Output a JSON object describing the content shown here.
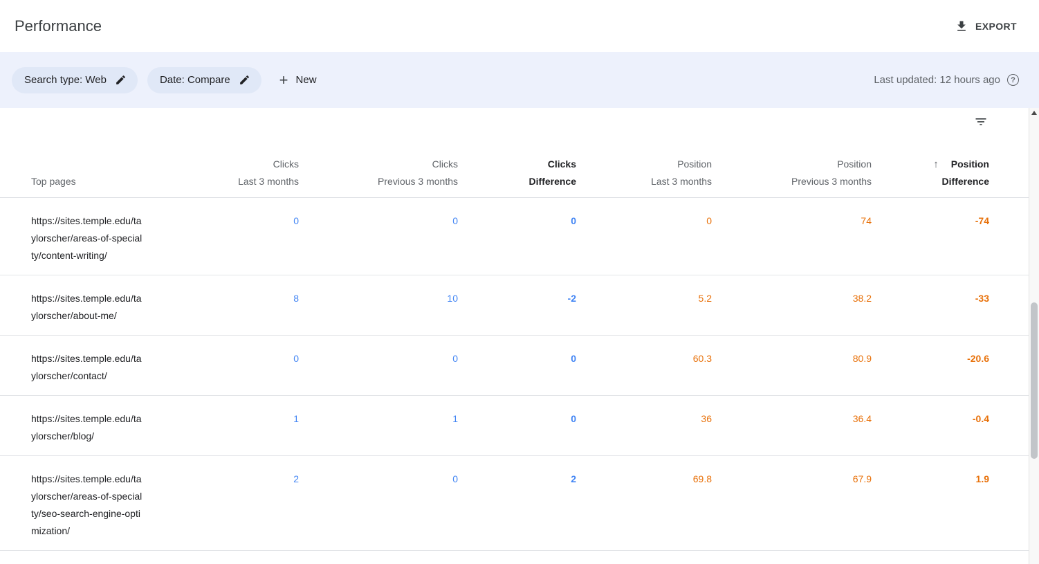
{
  "header": {
    "title": "Performance",
    "export_label": "EXPORT"
  },
  "filter_bar": {
    "chips": [
      {
        "label": "Search type: Web"
      },
      {
        "label": "Date: Compare"
      }
    ],
    "plus_symbol": "+",
    "new_label": "New",
    "last_updated": "Last updated: 12 hours ago",
    "help_symbol": "?"
  },
  "table": {
    "row_header": "Top pages",
    "sort_arrow": "↑",
    "columns": [
      {
        "line1": "Clicks",
        "line2": "Last 3 months"
      },
      {
        "line1": "Clicks",
        "line2": "Previous 3 months"
      },
      {
        "line1": "Clicks",
        "line2": "Difference"
      },
      {
        "line1": "Position",
        "line2": "Last 3 months"
      },
      {
        "line1": "Position",
        "line2": "Previous 3 months"
      },
      {
        "line1": "Position",
        "line2": "Difference"
      }
    ],
    "rows": [
      {
        "page": "https://sites.temple.edu/taylorscher/areas-of-specialty/content-writing/",
        "clicks_last": "0",
        "clicks_previous": "0",
        "clicks_difference": "0",
        "position_last": "0",
        "position_previous": "74",
        "position_difference": "-74"
      },
      {
        "page": "https://sites.temple.edu/taylorscher/about-me/",
        "clicks_last": "8",
        "clicks_previous": "10",
        "clicks_difference": "-2",
        "position_last": "5.2",
        "position_previous": "38.2",
        "position_difference": "-33"
      },
      {
        "page": "https://sites.temple.edu/taylorscher/contact/",
        "clicks_last": "0",
        "clicks_previous": "0",
        "clicks_difference": "0",
        "position_last": "60.3",
        "position_previous": "80.9",
        "position_difference": "-20.6"
      },
      {
        "page": "https://sites.temple.edu/taylorscher/blog/",
        "clicks_last": "1",
        "clicks_previous": "1",
        "clicks_difference": "0",
        "position_last": "36",
        "position_previous": "36.4",
        "position_difference": "-0.4"
      },
      {
        "page": "https://sites.temple.edu/taylorscher/areas-of-specialty/seo-search-engine-optimization/",
        "clicks_last": "2",
        "clicks_previous": "0",
        "clicks_difference": "2",
        "position_last": "69.8",
        "position_previous": "67.9",
        "position_difference": "1.9"
      }
    ]
  },
  "icons": {
    "export": "download-icon",
    "chip_edit": "pencil-icon",
    "new": "plus-icon",
    "help": "question-circle-icon",
    "table_filter": "filter-list-icon",
    "sort": "arrow-up-icon",
    "scroll_up": "triangle-up-icon"
  },
  "colors": {
    "clicks_color": "#4285f4",
    "position_color": "#e8710a",
    "filterbar_bg": "#edf1fc",
    "chip_bg": "#e0e8f7"
  }
}
